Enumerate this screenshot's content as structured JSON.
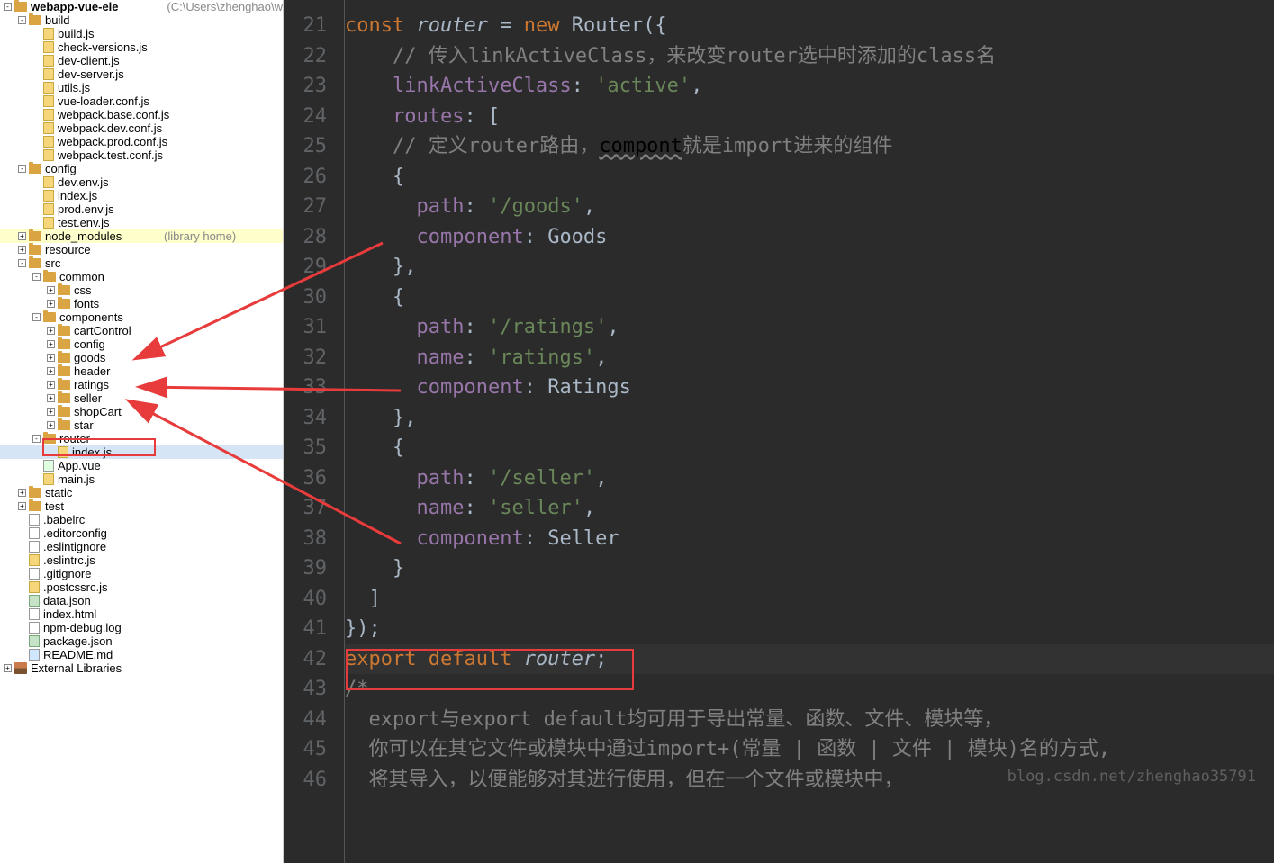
{
  "project": {
    "name": "webapp-vue-ele",
    "path": "(C:\\Users\\zhenghao\\w"
  },
  "tree": [
    {
      "d": 0,
      "t": "folder",
      "tg": "-",
      "l": "webapp-vue-ele",
      "b": true,
      "suf": "path"
    },
    {
      "d": 1,
      "t": "folder",
      "tg": "-",
      "l": "build"
    },
    {
      "d": 2,
      "t": "js",
      "tg": " ",
      "l": "build.js"
    },
    {
      "d": 2,
      "t": "js",
      "tg": " ",
      "l": "check-versions.js"
    },
    {
      "d": 2,
      "t": "js",
      "tg": " ",
      "l": "dev-client.js"
    },
    {
      "d": 2,
      "t": "js",
      "tg": " ",
      "l": "dev-server.js"
    },
    {
      "d": 2,
      "t": "js",
      "tg": " ",
      "l": "utils.js"
    },
    {
      "d": 2,
      "t": "js",
      "tg": " ",
      "l": "vue-loader.conf.js"
    },
    {
      "d": 2,
      "t": "js",
      "tg": " ",
      "l": "webpack.base.conf.js"
    },
    {
      "d": 2,
      "t": "js",
      "tg": " ",
      "l": "webpack.dev.conf.js"
    },
    {
      "d": 2,
      "t": "js",
      "tg": " ",
      "l": "webpack.prod.conf.js"
    },
    {
      "d": 2,
      "t": "js",
      "tg": " ",
      "l": "webpack.test.conf.js"
    },
    {
      "d": 1,
      "t": "folder",
      "tg": "-",
      "l": "config"
    },
    {
      "d": 2,
      "t": "js",
      "tg": " ",
      "l": "dev.env.js"
    },
    {
      "d": 2,
      "t": "js",
      "tg": " ",
      "l": "index.js"
    },
    {
      "d": 2,
      "t": "js",
      "tg": " ",
      "l": "prod.env.js"
    },
    {
      "d": 2,
      "t": "js",
      "tg": " ",
      "l": "test.env.js"
    },
    {
      "d": 1,
      "t": "folder",
      "tg": "+",
      "l": "node_modules",
      "lib": "(library home)",
      "hl": true
    },
    {
      "d": 1,
      "t": "folder",
      "tg": "+",
      "l": "resource"
    },
    {
      "d": 1,
      "t": "folder",
      "tg": "-",
      "l": "src"
    },
    {
      "d": 2,
      "t": "folder",
      "tg": "-",
      "l": "common"
    },
    {
      "d": 3,
      "t": "folder",
      "tg": "+",
      "l": "css"
    },
    {
      "d": 3,
      "t": "folder",
      "tg": "+",
      "l": "fonts"
    },
    {
      "d": 2,
      "t": "folder",
      "tg": "-",
      "l": "components"
    },
    {
      "d": 3,
      "t": "folder",
      "tg": "+",
      "l": "cartControl"
    },
    {
      "d": 3,
      "t": "folder",
      "tg": "+",
      "l": "config"
    },
    {
      "d": 3,
      "t": "folder",
      "tg": "+",
      "l": "goods"
    },
    {
      "d": 3,
      "t": "folder",
      "tg": "+",
      "l": "header"
    },
    {
      "d": 3,
      "t": "folder",
      "tg": "+",
      "l": "ratings"
    },
    {
      "d": 3,
      "t": "folder",
      "tg": "+",
      "l": "seller"
    },
    {
      "d": 3,
      "t": "folder",
      "tg": "+",
      "l": "shopCart"
    },
    {
      "d": 3,
      "t": "folder",
      "tg": "+",
      "l": "star"
    },
    {
      "d": 2,
      "t": "folder",
      "tg": "-",
      "l": "router"
    },
    {
      "d": 3,
      "t": "js",
      "tg": " ",
      "l": "index.js",
      "sel": true
    },
    {
      "d": 2,
      "t": "vue",
      "tg": " ",
      "l": "App.vue"
    },
    {
      "d": 2,
      "t": "js",
      "tg": " ",
      "l": "main.js"
    },
    {
      "d": 1,
      "t": "folder",
      "tg": "+",
      "l": "static"
    },
    {
      "d": 1,
      "t": "folder",
      "tg": "+",
      "l": "test"
    },
    {
      "d": 1,
      "t": "file",
      "tg": " ",
      "l": ".babelrc"
    },
    {
      "d": 1,
      "t": "file",
      "tg": " ",
      "l": ".editorconfig"
    },
    {
      "d": 1,
      "t": "file",
      "tg": " ",
      "l": ".eslintignore"
    },
    {
      "d": 1,
      "t": "js",
      "tg": " ",
      "l": ".eslintrc.js"
    },
    {
      "d": 1,
      "t": "file",
      "tg": " ",
      "l": ".gitignore"
    },
    {
      "d": 1,
      "t": "js",
      "tg": " ",
      "l": ".postcssrc.js"
    },
    {
      "d": 1,
      "t": "json",
      "tg": " ",
      "l": "data.json"
    },
    {
      "d": 1,
      "t": "file",
      "tg": " ",
      "l": "index.html"
    },
    {
      "d": 1,
      "t": "file",
      "tg": " ",
      "l": "npm-debug.log"
    },
    {
      "d": 1,
      "t": "json",
      "tg": " ",
      "l": "package.json"
    },
    {
      "d": 1,
      "t": "md",
      "tg": " ",
      "l": "README.md"
    },
    {
      "d": 0,
      "t": "lib",
      "tg": "+",
      "l": "External Libraries"
    }
  ],
  "code": {
    "start": 21,
    "lines": [
      {
        "t": [
          [
            "kw",
            "const "
          ],
          [
            "ital",
            "router"
          ],
          [
            "def",
            " = "
          ],
          [
            "kw",
            "new "
          ],
          [
            "def",
            "Router"
          ],
          [
            "bracket",
            "({"
          ]
        ]
      },
      {
        "t": [
          [
            "def",
            "    "
          ],
          [
            "comment",
            "// 传入linkActiveClass，来改变router选中时添加的class名"
          ]
        ]
      },
      {
        "t": [
          [
            "def",
            "    "
          ],
          [
            "prop",
            "linkActiveClass"
          ],
          [
            "def",
            ": "
          ],
          [
            "str",
            "'active'"
          ],
          [
            "def",
            ","
          ]
        ]
      },
      {
        "t": [
          [
            "def",
            "    "
          ],
          [
            "prop",
            "routes"
          ],
          [
            "def",
            ": ["
          ]
        ]
      },
      {
        "t": [
          [
            "def",
            "    "
          ],
          [
            "comment",
            "// 定义router路由，"
          ],
          [
            "wavy",
            "compont"
          ],
          [
            "comment",
            "就是import进来的组件"
          ]
        ]
      },
      {
        "t": [
          [
            "def",
            "    {"
          ]
        ]
      },
      {
        "t": [
          [
            "def",
            "      "
          ],
          [
            "prop",
            "path"
          ],
          [
            "def",
            ": "
          ],
          [
            "str",
            "'/goods'"
          ],
          [
            "def",
            ","
          ]
        ]
      },
      {
        "t": [
          [
            "def",
            "      "
          ],
          [
            "prop",
            "component"
          ],
          [
            "def",
            ": Goods"
          ]
        ]
      },
      {
        "t": [
          [
            "def",
            "    },"
          ]
        ]
      },
      {
        "t": [
          [
            "def",
            "    {"
          ]
        ]
      },
      {
        "t": [
          [
            "def",
            "      "
          ],
          [
            "prop",
            "path"
          ],
          [
            "def",
            ": "
          ],
          [
            "str",
            "'/ratings'"
          ],
          [
            "def",
            ","
          ]
        ]
      },
      {
        "t": [
          [
            "def",
            "      "
          ],
          [
            "prop",
            "name"
          ],
          [
            "def",
            ": "
          ],
          [
            "str",
            "'ratings'"
          ],
          [
            "def",
            ","
          ]
        ]
      },
      {
        "t": [
          [
            "def",
            "      "
          ],
          [
            "prop",
            "component"
          ],
          [
            "def",
            ": Ratings"
          ]
        ]
      },
      {
        "t": [
          [
            "def",
            "    },"
          ]
        ]
      },
      {
        "t": [
          [
            "def",
            "    {"
          ]
        ]
      },
      {
        "t": [
          [
            "def",
            "      "
          ],
          [
            "prop",
            "path"
          ],
          [
            "def",
            ": "
          ],
          [
            "str",
            "'/seller'"
          ],
          [
            "def",
            ","
          ]
        ]
      },
      {
        "t": [
          [
            "def",
            "      "
          ],
          [
            "prop",
            "name"
          ],
          [
            "def",
            ": "
          ],
          [
            "str",
            "'seller'"
          ],
          [
            "def",
            ","
          ]
        ]
      },
      {
        "t": [
          [
            "def",
            "      "
          ],
          [
            "prop",
            "component"
          ],
          [
            "def",
            ": Seller"
          ]
        ]
      },
      {
        "t": [
          [
            "def",
            "    }"
          ]
        ]
      },
      {
        "t": [
          [
            "def",
            "  ]"
          ]
        ]
      },
      {
        "t": [
          [
            "bracket",
            "});"
          ]
        ]
      },
      {
        "t": [
          [
            "kw",
            "export default "
          ],
          [
            "ital",
            "router"
          ],
          [
            "def",
            ";"
          ]
        ],
        "cl": "cl42"
      },
      {
        "t": [
          [
            "comment",
            "/*"
          ]
        ]
      },
      {
        "t": [
          [
            "comment",
            "  export与export default均可用于导出常量、函数、文件、模块等，"
          ]
        ]
      },
      {
        "t": [
          [
            "comment",
            "  你可以在其它文件或模块中通过import+(常量 | 函数 | 文件 | 模块)名的方式,"
          ]
        ]
      },
      {
        "t": [
          [
            "comment",
            "  将其导入，以便能够对其进行使用，但在一个文件或模块中，"
          ]
        ]
      }
    ]
  },
  "watermark": "blog.csdn.net/zhenghao35791"
}
